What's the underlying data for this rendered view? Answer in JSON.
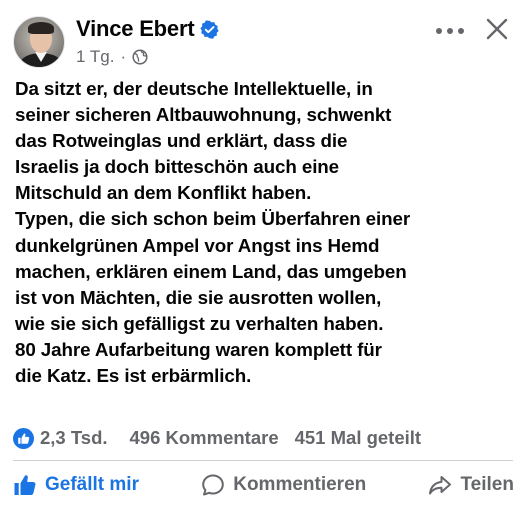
{
  "post": {
    "author": "Vince Ebert",
    "time": "1 Tg.",
    "separator": "·",
    "text": "Da sitzt er, der deutsche Intellektuelle, in\nseiner sicheren Altbauwohnung, schwenkt\ndas Rotweinglas und erklärt, dass die\nIsraelis ja doch bitteschön auch eine\nMitschuld an dem Konflikt haben.\nTypen, die sich schon beim Überfahren einer\ndunkelgrünen Ampel vor Angst ins Hemd\nmachen, erklären einem Land, das umgeben\nist von Mächten, die sie ausrotten wollen,\nwie sie sich gefälligst zu verhalten haben.\n80 Jahre Aufarbeitung waren komplett für\ndie Katz. Es ist erbärmlich."
  },
  "stats": {
    "reactions": "2,3 Tsd.",
    "comments": "496 Kommentare",
    "shares": "451 Mal geteilt"
  },
  "actions": {
    "like_label": "Gefällt mir",
    "comment_label": "Kommentieren",
    "share_label": "Teilen"
  },
  "icons": {
    "verified": "verified-badge-icon",
    "privacy": "globe-icon",
    "more": "more-dots-icon",
    "close": "close-icon",
    "like": "thumbs-up-icon",
    "comment": "comment-bubble-icon",
    "share": "share-arrow-icon"
  },
  "colors": {
    "accent": "#1b74e4",
    "text": "#050505",
    "secondary": "#65676b",
    "divider": "#ced0d4"
  }
}
